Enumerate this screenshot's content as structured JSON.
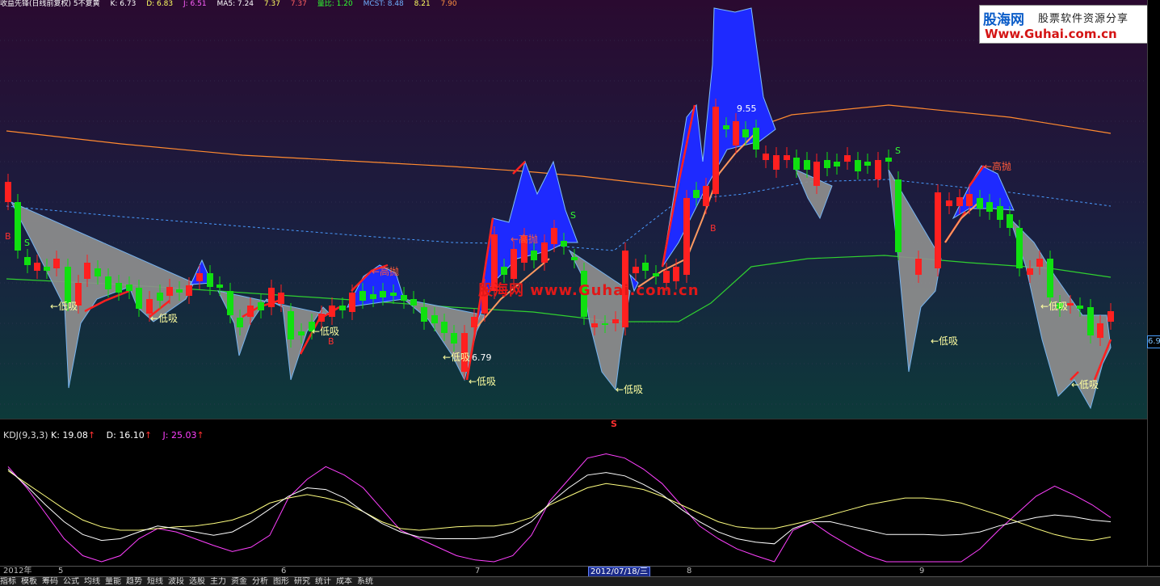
{
  "top_info": [
    "收益先锋(日线前复权) 5不复黄",
    "K: 6.73",
    "D: 6.83",
    "J: 6.51",
    "MA5: 7.24",
    "7.37",
    "7.37",
    "量比: 1.20",
    "MCST: 8.48",
    "8.21",
    "7.90"
  ],
  "logo": {
    "brand": "股海网",
    "slogan": "股票软件资源分享",
    "url": "Www.Guhai.com.cn"
  },
  "watermark": "股海网 www.Guhai.com.cn",
  "annotations": {
    "buy_low": "←低吸",
    "sell_high": "←高抛",
    "b": "B",
    "s": "S",
    "high_price": "9.55",
    "low_price": "6.79"
  },
  "price_tag": "6.9",
  "kdj": {
    "name": "KDJ(9,3,3)",
    "k": "K: 19.08",
    "d": "D: 16.10",
    "j": "J: 25.03",
    "arrow": "↑"
  },
  "divider_mark": "S",
  "time_axis": {
    "year": "2012年",
    "months": [
      "5",
      "6",
      "7",
      "8",
      "9"
    ],
    "cursor_date": "2012/07/18/三"
  },
  "toolbar_items": [
    "指标",
    "模板",
    "筹码",
    "公式",
    "均线",
    "量能",
    "趋势",
    "短线",
    "波段",
    "选股",
    "主力",
    "资金",
    "分析",
    "图形",
    "研究",
    "统计",
    "成本",
    "系统"
  ],
  "colors": {
    "up": "#ff2020",
    "down": "#10e010",
    "blue_fill": "#1e2aff",
    "gray_fill": "#8a8a8a",
    "kdj_j": "#ff40ff",
    "kdj_d": "#ffff80",
    "kdj_k": "#ffffff"
  }
}
